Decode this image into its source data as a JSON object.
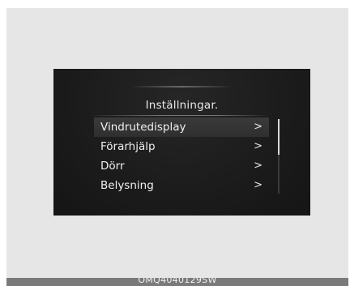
{
  "screen": {
    "title": "Inställningar.",
    "menu": [
      {
        "label": "Vindrutedisplay",
        "chevron": ">",
        "selected": true
      },
      {
        "label": "Förarhjälp",
        "chevron": ">",
        "selected": false
      },
      {
        "label": "Dörr",
        "chevron": ">",
        "selected": false
      },
      {
        "label": "Belysning",
        "chevron": ">",
        "selected": false
      }
    ],
    "scroll_position": 0
  },
  "caption": "OMQ4040129SW",
  "colors": {
    "page_background": "#e6e6e6",
    "screen_background": "#1b1b1b",
    "selected_row": "#3a3a3a",
    "text": "#f0f0f0",
    "caption_bar": "#7a7a7a"
  }
}
